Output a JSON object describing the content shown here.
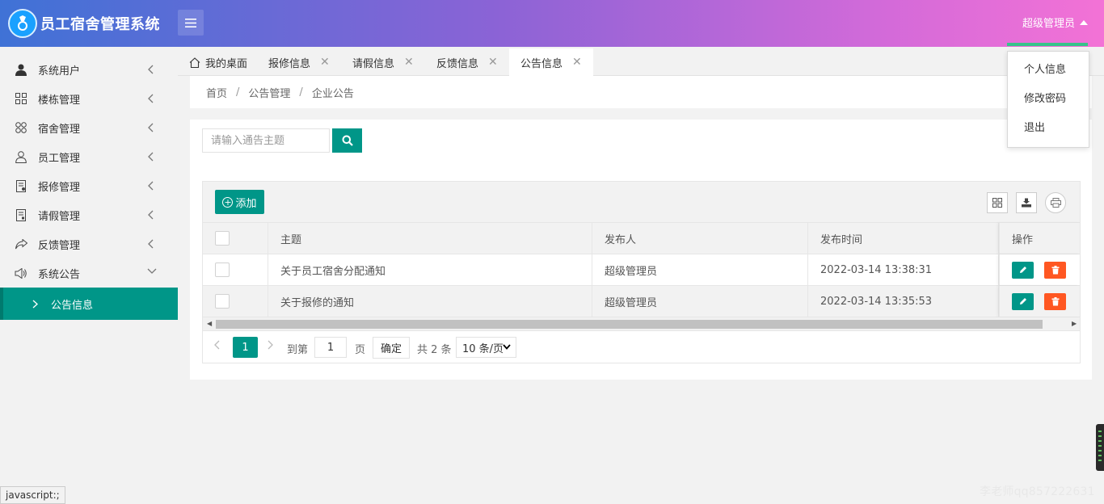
{
  "header": {
    "title": "员工宿舍管理系统",
    "user_label": "超级管理员"
  },
  "user_dropdown": {
    "items": [
      "个人信息",
      "修改密码",
      "退出"
    ]
  },
  "sidebar": {
    "items": [
      {
        "label": "系统用户",
        "icon": "user-icon"
      },
      {
        "label": "楼栋管理",
        "icon": "grid-icon"
      },
      {
        "label": "宿舍管理",
        "icon": "clover-icon"
      },
      {
        "label": "员工管理",
        "icon": "person-icon"
      },
      {
        "label": "报修管理",
        "icon": "document-icon"
      },
      {
        "label": "请假管理",
        "icon": "form-icon"
      },
      {
        "label": "反馈管理",
        "icon": "share-icon"
      },
      {
        "label": "系统公告",
        "icon": "speaker-icon"
      }
    ],
    "active_sub": "公告信息"
  },
  "tabs": [
    {
      "label": "我的桌面"
    },
    {
      "label": "报修信息"
    },
    {
      "label": "请假信息"
    },
    {
      "label": "反馈信息"
    },
    {
      "label": "公告信息"
    }
  ],
  "breadcrumb": [
    "首页",
    "公告管理",
    "企业公告"
  ],
  "search": {
    "placeholder": "请输入通告主题"
  },
  "toolbar": {
    "add_label": "添加"
  },
  "table": {
    "columns": [
      "主题",
      "发布人",
      "发布时间",
      "操作"
    ],
    "rows": [
      {
        "title": "关于员工宿舍分配通知",
        "author": "超级管理员",
        "time": "2022-03-14 13:38:31"
      },
      {
        "title": "关于报修的通知",
        "author": "超级管理员",
        "time": "2022-03-14 13:35:53"
      }
    ]
  },
  "pagination": {
    "current_page": "1",
    "goto_label": "到第",
    "goto_value": "1",
    "page_label": "页",
    "confirm_label": "确定",
    "total_label": "共 2 条",
    "page_size": "10 条/页"
  },
  "status_tip": "javascript:;",
  "watermark": "李老师qq857222631",
  "colors": {
    "primary": "#009688",
    "danger": "#ff5722",
    "header_start": "#3f72d6",
    "header_end": "#f372d6"
  }
}
